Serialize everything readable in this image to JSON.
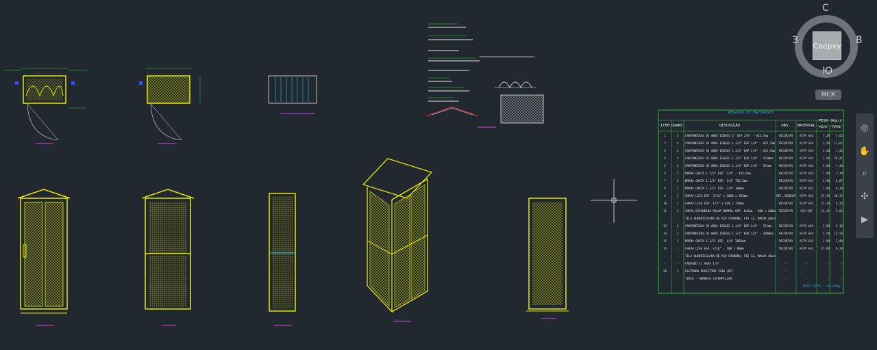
{
  "viewcube": {
    "face_label": "Сверху",
    "north": "С",
    "south": "Ю",
    "west": "З",
    "east": "В"
  },
  "wcs_label": "МСК",
  "navbar": {
    "icons": [
      "steering-wheel-icon",
      "pan-icon",
      "zoom-icon",
      "orbit-icon",
      "showmotion-icon"
    ]
  },
  "drawing": {
    "view_labels": [
      "VISTA FRONTAL",
      "PLANTA",
      "PLANTA DE COBERTURA",
      "DETALHAMENTO",
      "VISTA FRONTAL",
      "CORTE A-A",
      "CORTE B-B",
      "ISOMÉTRICO",
      "TRASEIRA"
    ],
    "colors": {
      "yellow": "#e8e800",
      "green": "#34d634",
      "cyan": "#22c8e8",
      "magenta": "#e040e0",
      "red": "#e03030",
      "white": "#e8e8e8",
      "blue": "#3050ff"
    }
  },
  "bom_table": {
    "title": "RELAÇÃO DE MATERIAIS",
    "headers": [
      "ITEM",
      "QUANT.",
      "DESCRIÇÃO",
      "OBS.",
      "MATERIAL",
      "PESO (Kg.)",
      "KG/m",
      "TOTAL"
    ],
    "rows": [
      [
        "1",
        "2",
        "CANTONEIRAS DE ABAS IGUAIS 3\" ESP.1/4\" - 923,7mm",
        "RECORTAR",
        "ASTM A36",
        "7,29",
        "7,61"
      ],
      [
        "2",
        "4",
        "CANTONEIRAS DE ABAS IGUAIS 1.1/2\" ESP.1/4\" - 923,7mm",
        "RECORTAR",
        "ASTM A36",
        "3,50",
        "11,61"
      ],
      [
        "3",
        "4",
        "CANTONEIRAS DE ABAS IGUAIS 1.1/2\" ESP.1/4\" - 523,7mm",
        "RECORTAR",
        "ASTM A36",
        "3,50",
        "7,32"
      ],
      [
        "4",
        "4",
        "CANTONEIRAS DE ABAS IGUAIS 1.1/2\" ESP.1/4\" - 2130mm",
        "RECORTAR",
        "ASTM A36",
        "3,50",
        "29,41"
      ],
      [
        "5",
        "2",
        "CANTONEIRAS DE ABAS IGUAIS 1.1/2\" ESP.1/4\" - 531mm",
        "RECORTAR",
        "ASTM A36",
        "3,50",
        "7,44"
      ],
      [
        "6",
        "2",
        "BARRA CHATA 1.1/2\" ESP. 1/4\" - 445,6mm",
        "RECORTAR",
        "ASTM A36",
        "1,90",
        "1,70"
      ],
      [
        "7",
        "2",
        "BARRA CHATA 1.1/2\" ESP. 1/4\" 756,5mm",
        "RECORTAR",
        "ASTM A36",
        "1,90",
        "2,87"
      ],
      [
        "8",
        "2",
        "BARRA CHATA 1.1/2\" ESP. 1/4\" 100mm",
        "RECORTAR",
        "ASTM A36",
        "1,90",
        "0,38"
      ],
      [
        "9",
        "1",
        "CHAPA LISA ESP. 3/16\" x 1060 x 503mm",
        "REC./DOBRAR",
        "ASTM A36",
        "37,39",
        "20,71"
      ],
      [
        "10",
        "2",
        "CHAPA LISA ESP. 1/4\" x 818 x 130mm",
        "RECORTAR",
        "ASTM A36",
        "37,39",
        "6,33"
      ],
      [
        "11",
        "1",
        "CHAPA EXPANDIDA MALHA NORMAL EXP. 8/6mm - 806 x 260mm",
        "RECORTAR",
        "AÇO SAE",
        "13,41",
        "5,61"
      ],
      [
        "-",
        "-",
        "TELA QUADRICULADA DE AÇO CARBONO, FIO 12, MALHA 40x100mm - 6,00m²",
        "-",
        "-",
        "-",
        "-"
      ],
      [
        "13",
        "2",
        "CANTONEIRAS DE ABAS IGUAIS 1.1/2\" ESP.1/4\" - 721mm",
        "RECORTAR",
        "ASTM A36",
        "3,50",
        "5,15"
      ],
      [
        "14",
        "2",
        "CANTONEIRAS DE ABAS IGUAIS 1.1/2\" ESP.1/4\" - 2090mm",
        "RECORTAR",
        "ASTM A36",
        "3,50",
        "14,56"
      ],
      [
        "15",
        "1",
        "BARRA CHATA 1.1/2\" ESP. 1/4\" 2003mm",
        "RECORTAR",
        "ASTM A36",
        "1,90",
        "3,80"
      ],
      [
        "16",
        "-",
        "CHAPA LISA ESP. 3/16\" - 100 x 80mm",
        "RECORTAR",
        "ASTM A36",
        "37,09",
        "0,19"
      ],
      [
        "-",
        "-",
        "TELA QUADRICULADA DE AÇO CARBONO, FIO 12, MALHA 40x100mm - 1,50m²",
        "-",
        "-",
        "-",
        "-"
      ],
      [
        "-",
        "-",
        "CADEADO C/ ABAS 1/4\"",
        "-",
        "-",
        "-",
        "-"
      ],
      [
        "20",
        "1",
        "ELETRODO REVESTIDO 7018 (BF)",
        "-",
        "-",
        "-",
        "-"
      ],
      [
        "-",
        "-",
        "TINTA - AMARELO CATERPILLAR",
        "-",
        "-",
        "-",
        "-"
      ]
    ],
    "footer": "PESO TOTAL: 138,63Kg"
  }
}
